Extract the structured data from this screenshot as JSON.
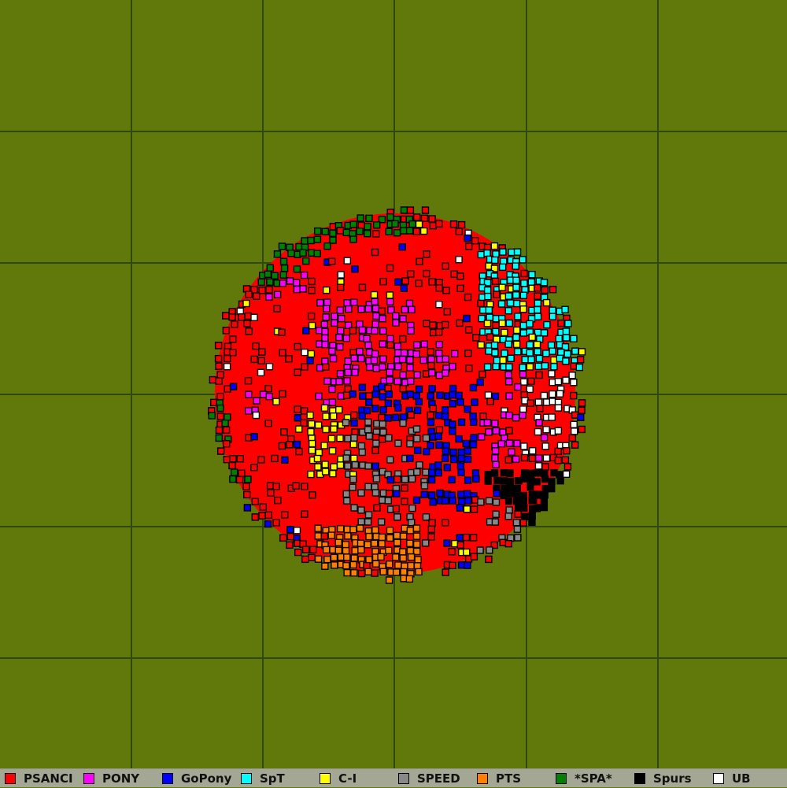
{
  "map": {
    "background_color": "#61790b",
    "grid_color": "#2e4a12",
    "grid_divisions": 6,
    "cell_outline_color": "#000000"
  },
  "legend": [
    {
      "label": "PSANCI",
      "color": "#ff0000"
    },
    {
      "label": "PONY",
      "color": "#ff00ff"
    },
    {
      "label": "GoPony",
      "color": "#0000ff"
    },
    {
      "label": "SpT",
      "color": "#00ffff"
    },
    {
      "label": "C-I",
      "color": "#ffff00"
    },
    {
      "label": "SPEED",
      "color": "#888888"
    },
    {
      "label": "PTS",
      "color": "#ff8000"
    },
    {
      "label": "*SPA*",
      "color": "#008000"
    },
    {
      "label": "Spurs",
      "color": "#000000"
    },
    {
      "label": "UB",
      "color": "#ffffff"
    }
  ]
}
